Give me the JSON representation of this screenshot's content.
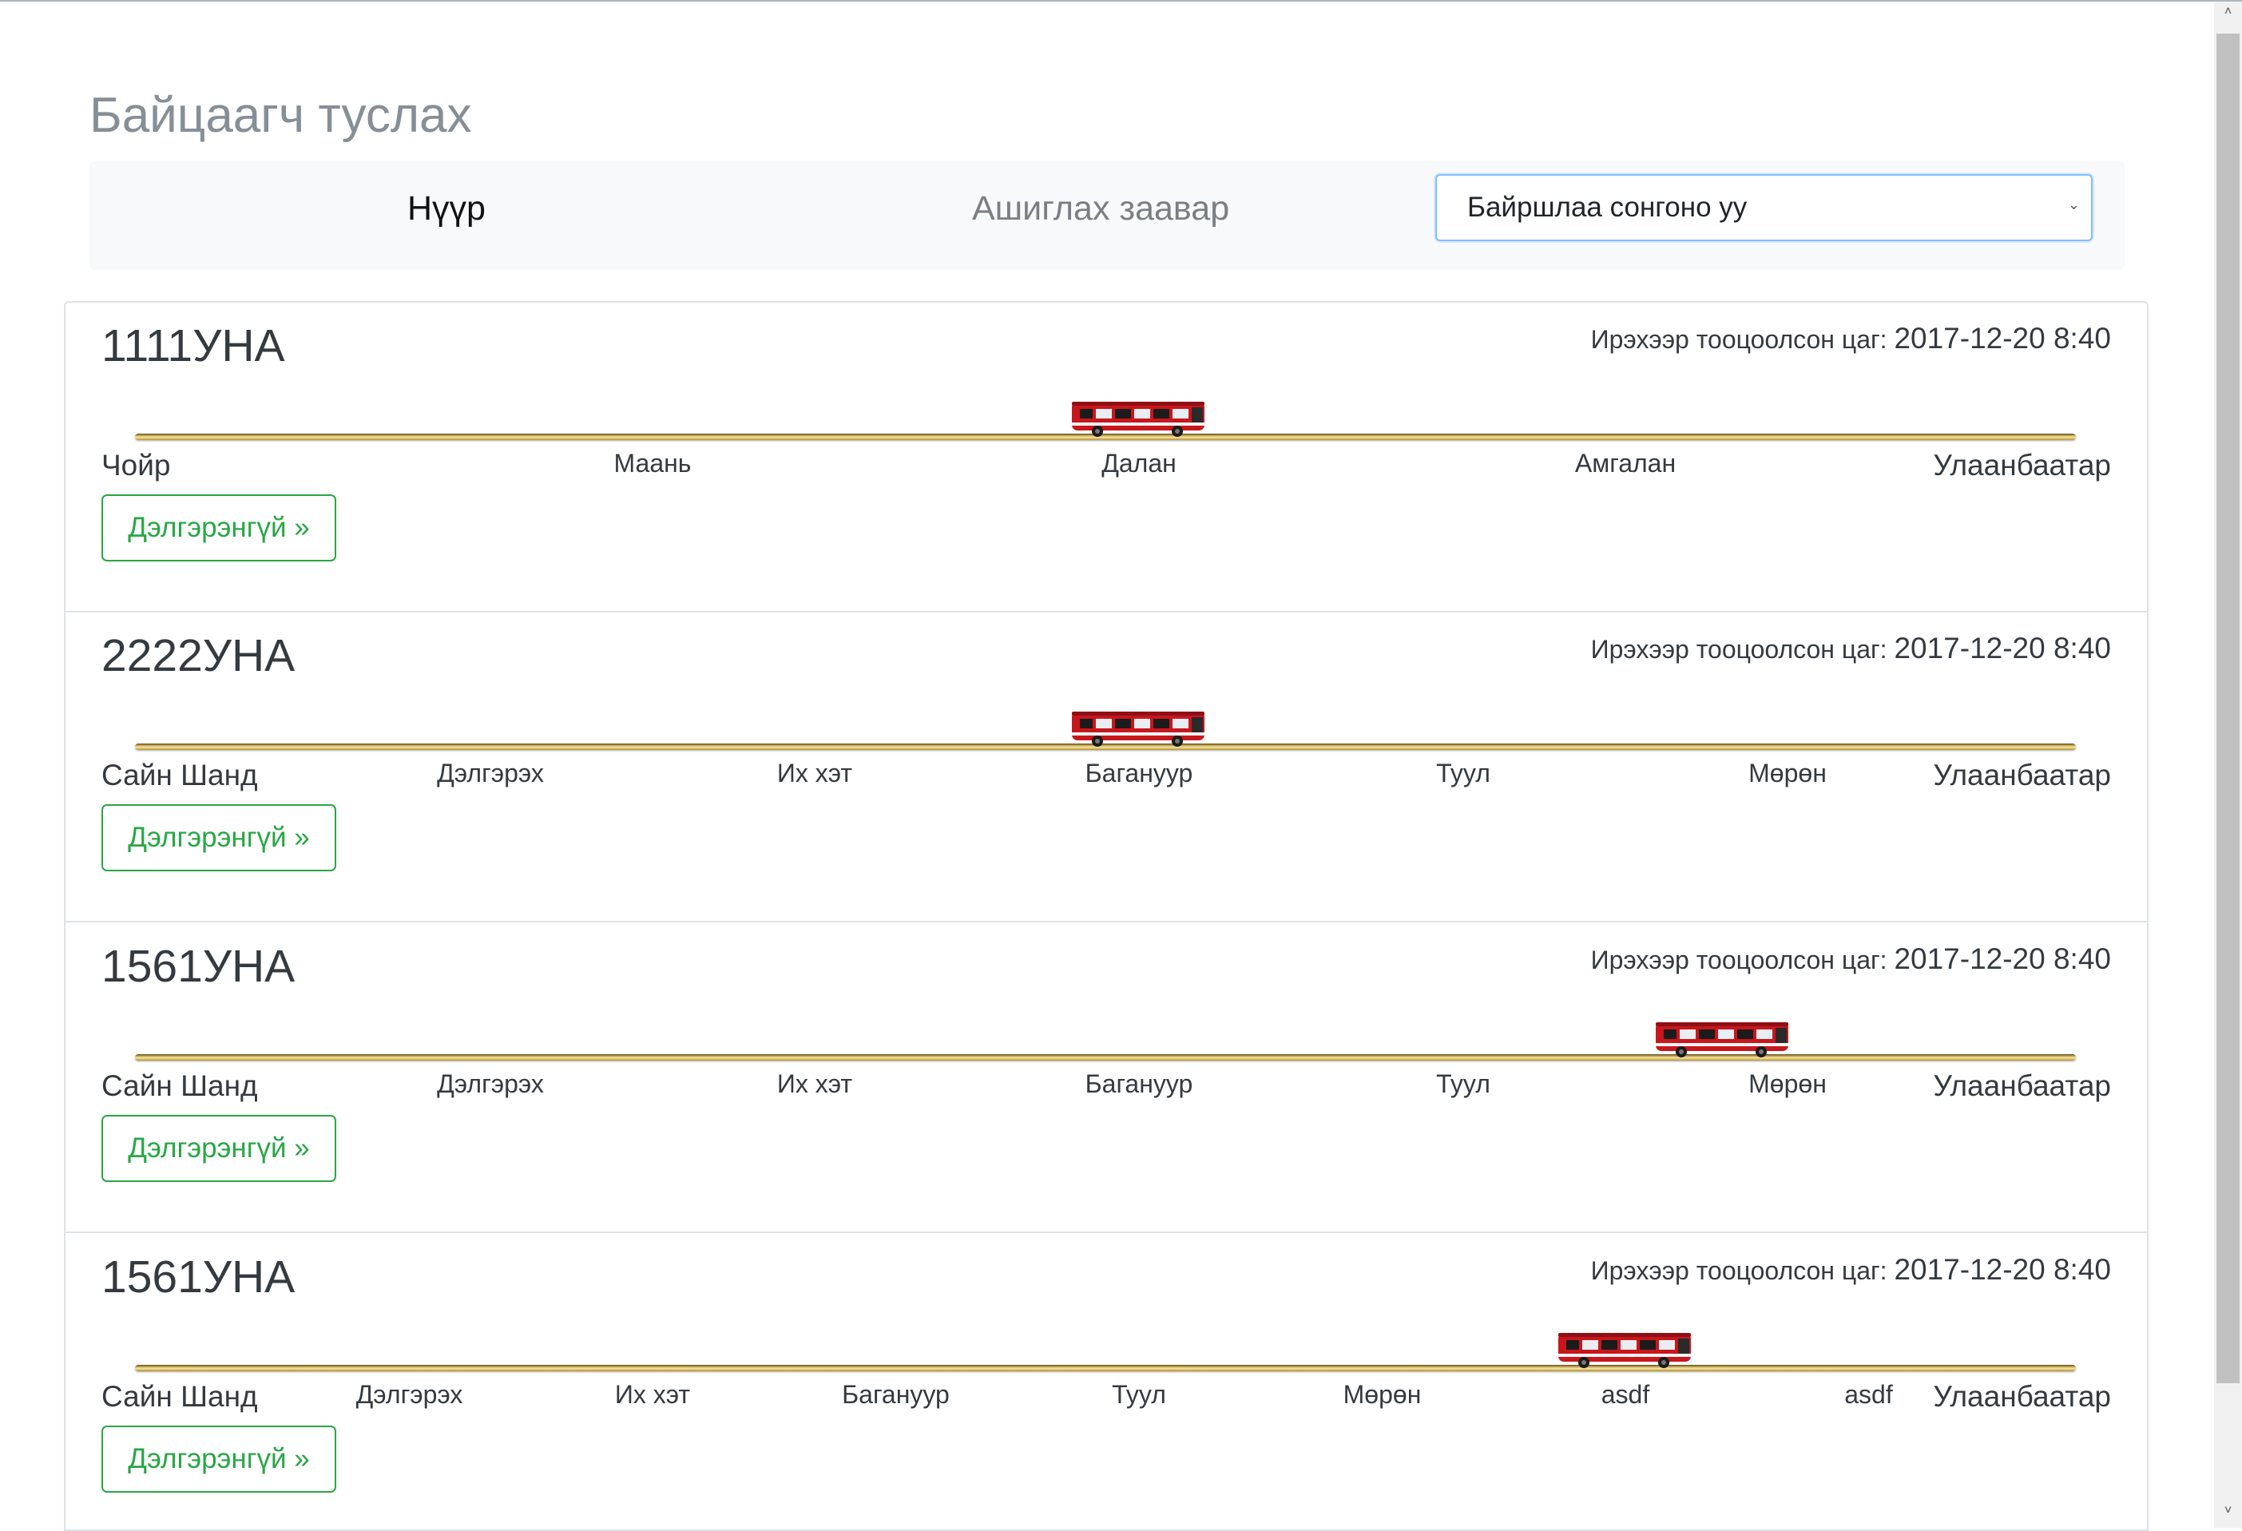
{
  "page": {
    "title": "Байцаагч туслах"
  },
  "nav": {
    "home_label": "Нүүр",
    "guide_label": "Ашиглах заавар",
    "location_select": {
      "selected": "Байршлаа сонгоно уу"
    }
  },
  "icons": {
    "bus": "bus-icon",
    "chevron": "chevron-down-icon"
  },
  "colors": {
    "bus_red": "#c8161d",
    "track_gold": "#c9a445",
    "button_green": "#28a745"
  },
  "routes": [
    {
      "plate": "1111УНА",
      "eta_label": "Ирэхээр тооцоолсон цаг:",
      "eta_value": "2017-12-20 8:40",
      "stops": [
        "Чойр",
        "Маань",
        "Далан",
        "Амгалан",
        "Улаанбаатар"
      ],
      "bus_progress": 0.5,
      "details_label": "Дэлгэрэнгүй »"
    },
    {
      "plate": "2222УНА",
      "eta_label": "Ирэхээр тооцоолсон цаг:",
      "eta_value": "2017-12-20 8:40",
      "stops": [
        "Сайн Шанд",
        "Дэлгэрэх",
        "Их хэт",
        "Багануур",
        "Туул",
        "Мөрөн",
        "Улаанбаатар"
      ],
      "bus_progress": 0.5,
      "details_label": "Дэлгэрэнгүй »"
    },
    {
      "plate": "1561УНА",
      "eta_label": "Ирэхээр тооцоолсон цаг:",
      "eta_value": "2017-12-20 8:40",
      "stops": [
        "Сайн Шанд",
        "Дэлгэрэх",
        "Их хэт",
        "Багануур",
        "Туул",
        "Мөрөн",
        "Улаанбаатар"
      ],
      "bus_progress": 0.8,
      "details_label": "Дэлгэрэнгүй »"
    },
    {
      "plate": "1561УНА",
      "eta_label": "Ирэхээр тооцоолсон цаг:",
      "eta_value": "2017-12-20 8:40",
      "stops": [
        "Сайн Шанд",
        "Дэлгэрэх",
        "Их хэт",
        "Багануур",
        "Туул",
        "Мөрөн",
        "asdf",
        "asdf",
        "Улаанбаатар"
      ],
      "bus_progress": 0.75,
      "details_label": "Дэлгэрэнгүй »"
    }
  ]
}
